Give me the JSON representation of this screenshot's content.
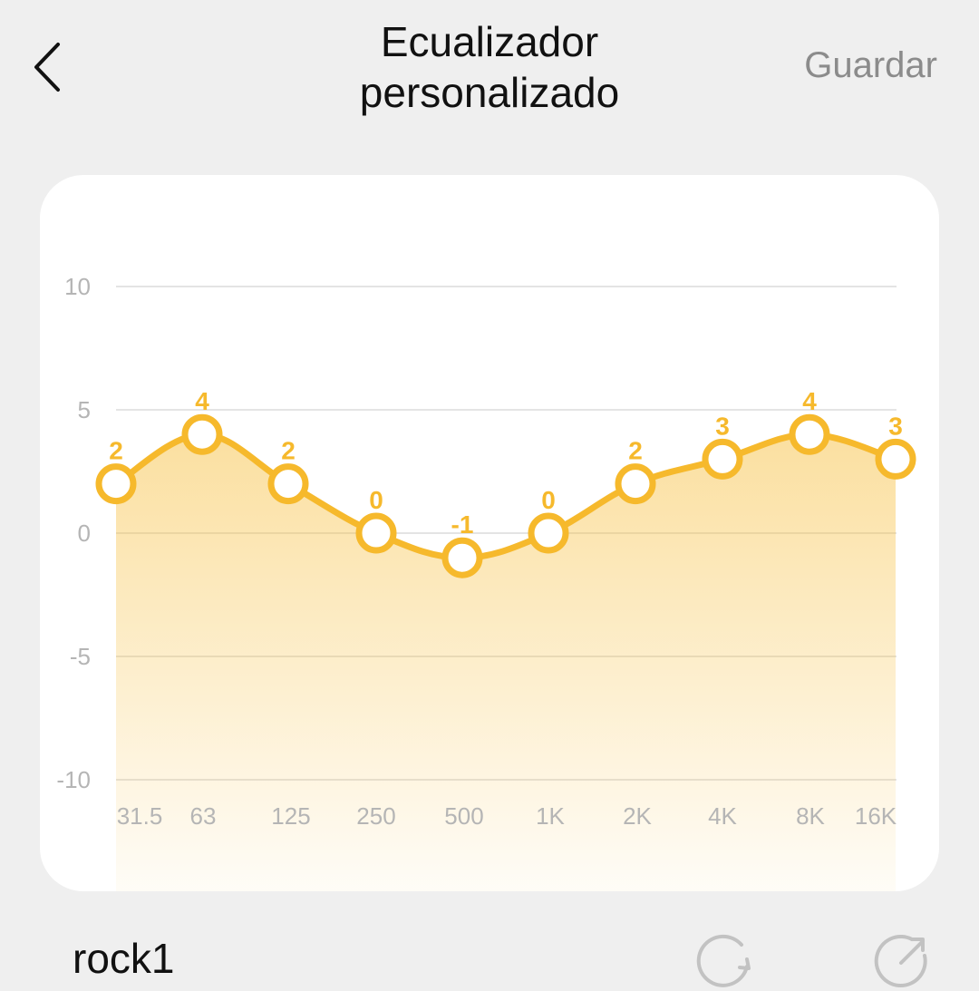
{
  "header": {
    "title": "Ecualizador\npersonalizado",
    "save_label": "Guardar",
    "back_icon": "chevron-left-icon"
  },
  "preset": {
    "name": "rock1",
    "reset_icon": "refresh-icon",
    "share_icon": "share-arrow-icon"
  },
  "colors": {
    "accent": "#f6b92c",
    "background": "#efefef",
    "card": "#ffffff",
    "muted_text": "#b5b5b5",
    "gridline": "#dcdcdc"
  },
  "chart_data": {
    "type": "line",
    "categories": [
      "31.5",
      "63",
      "125",
      "250",
      "500",
      "1K",
      "2K",
      "4K",
      "8K",
      "16K"
    ],
    "series": [
      {
        "values": [
          2,
          4,
          2,
          0,
          -1,
          0,
          2,
          3,
          4,
          3
        ]
      }
    ],
    "yticks": [
      10,
      5,
      0,
      -5,
      -10
    ],
    "ylim": [
      -10,
      10
    ],
    "grid": true,
    "area_fill": true,
    "data_labels": true
  }
}
